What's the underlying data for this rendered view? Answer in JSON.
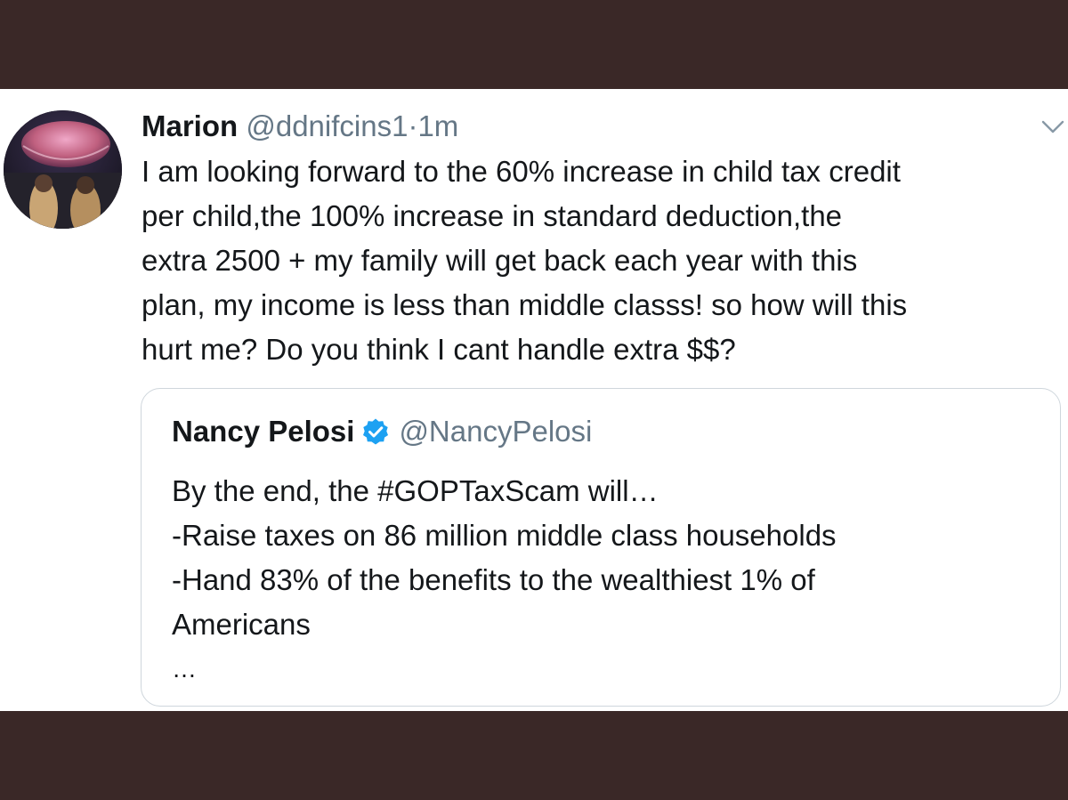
{
  "tweet": {
    "author_name": "Marion",
    "author_handle": "@ddnifcins1",
    "separator": "·",
    "time": "1m",
    "text_lines": [
      "I am looking forward to the 60% increase in child tax credit",
      "per child,the 100% increase in standard deduction,the",
      "extra 2500 + my family will get back each year with this",
      "plan, my income is less than middle classs! so how will this",
      "hurt me? Do you think I cant handle extra $$?"
    ]
  },
  "quoted_tweet": {
    "author_name": "Nancy Pelosi",
    "author_handle": "@NancyPelosi",
    "text_lines": [
      "By the end, the #GOPTaxScam will…",
      "-Raise taxes on 86 million middle class households",
      "-Hand 83% of the benefits to the wealthiest 1% of",
      "Americans"
    ],
    "truncation": "…"
  },
  "icons": {
    "avatar": "avatar-image",
    "caret": "chevron-down-icon",
    "verified": "verified-badge-icon"
  },
  "colors": {
    "frame_background": "#3a2827",
    "card_background": "#ffffff",
    "text_primary": "#14171a",
    "text_secondary": "#657786",
    "verified_blue": "#1da1f2",
    "quote_border": "#cfd6dc"
  }
}
